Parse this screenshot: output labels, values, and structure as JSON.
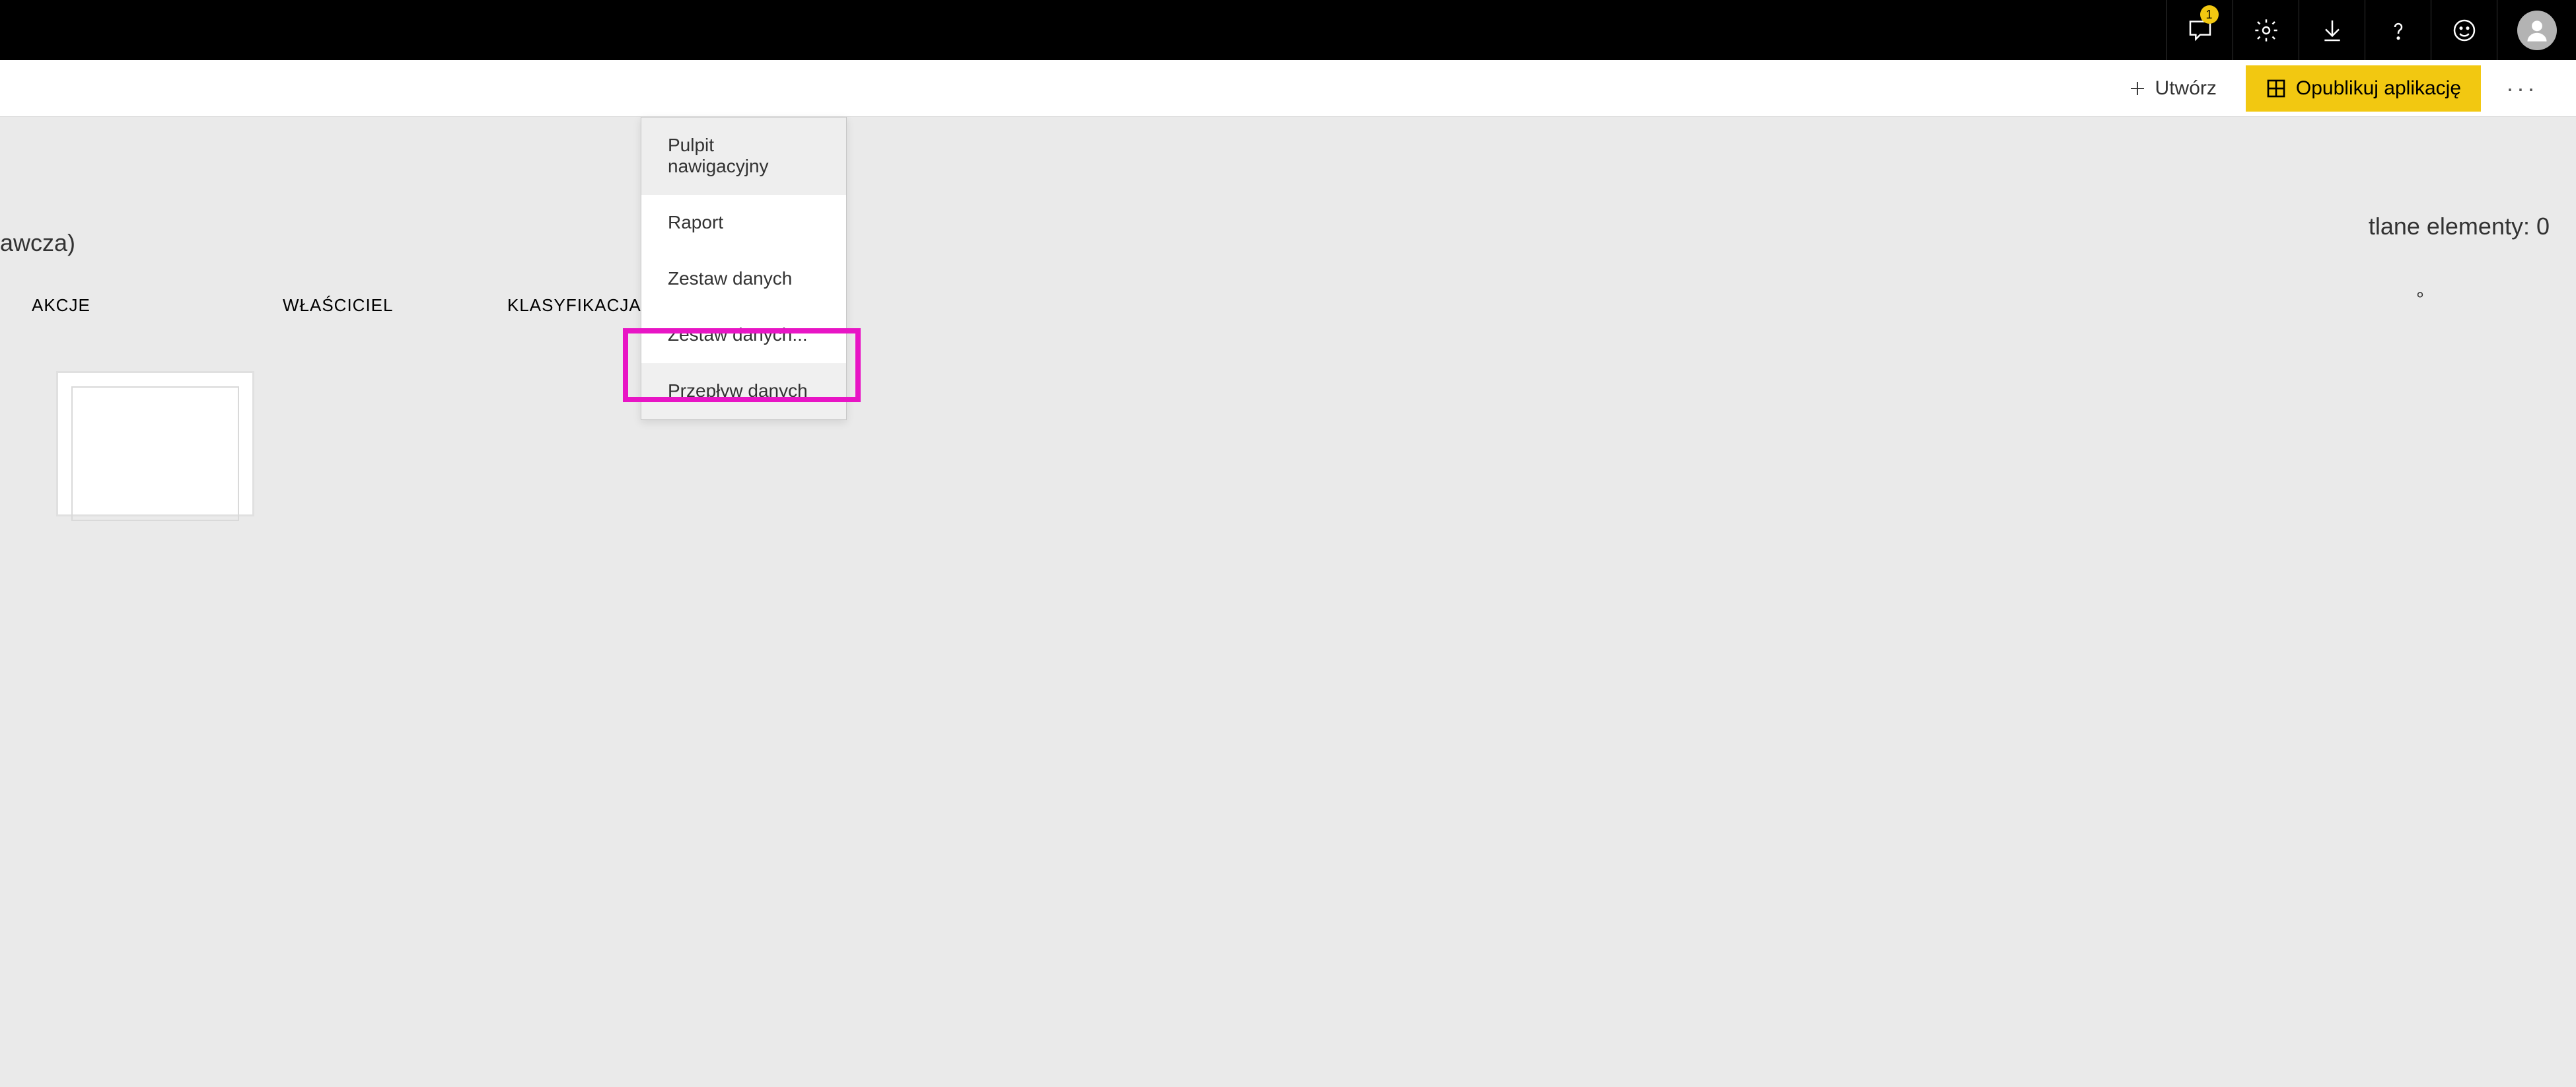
{
  "topbar": {
    "notification_count": "1"
  },
  "actionbar": {
    "create_label": "Utwórz",
    "publish_label": "Opublikuj aplikację"
  },
  "content": {
    "partial_label": "awcza)",
    "displayed_count_label": "tlane elementy: 0",
    "degree": "°",
    "columns": {
      "col1": "AKCJE",
      "col2": "WŁAŚCICIEL",
      "col3": "KLASYFIKACJA"
    }
  },
  "dropdown": {
    "items": [
      "Pulpit nawigacyjny",
      "Raport",
      "Zestaw danych",
      "Zestaw danych...",
      "Przepływ danych"
    ]
  }
}
